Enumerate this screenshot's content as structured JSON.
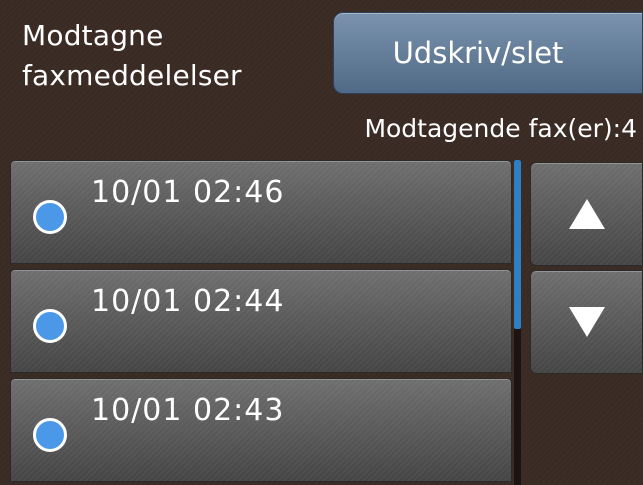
{
  "header": {
    "title": "Modtagne\nfaxmeddelelser",
    "print_delete_label": "Udskriv/slet"
  },
  "status": {
    "count_label": "Modtagende fax(er):4"
  },
  "fax_list": [
    {
      "time": "10/01 02:46"
    },
    {
      "time": "10/01 02:44"
    },
    {
      "time": "10/01 02:43"
    }
  ],
  "scroll": {
    "up_icon": "up-arrow-icon",
    "down_icon": "down-arrow-icon"
  },
  "colors": {
    "background": "#3a2a24",
    "accent_button": "#5f7a98",
    "dot": "#4b98e8",
    "scrollbar": "#2f7fc4"
  }
}
